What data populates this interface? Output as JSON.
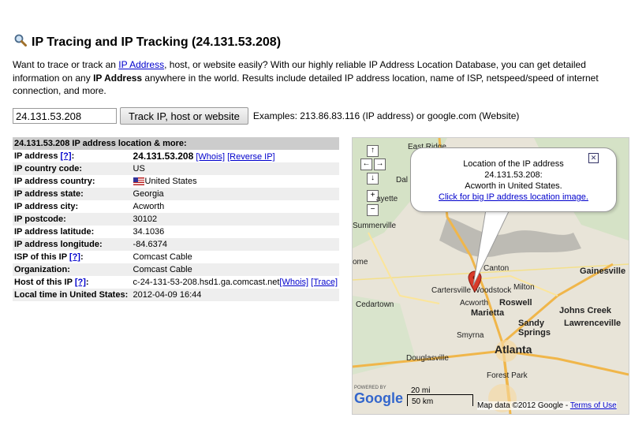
{
  "header": {
    "title": "IP Tracing and IP Tracking (24.131.53.208)",
    "icon": "magnifier-icon"
  },
  "intro": {
    "part1": "Want to trace or track an ",
    "link_ip": "IP Address",
    "part2": ", host, or website easily? With our highly reliable IP Address Location Database, you can get detailed information on any ",
    "bold_ip": "IP Address",
    "part3": " anywhere in the world. Results include detailed IP address location, name of ISP, netspeed/speed of internet connection, and more."
  },
  "search": {
    "value": "24.131.53.208",
    "button_label": "Track IP, host or website",
    "examples": "Examples: 213.86.83.116 (IP address) or google.com (Website)"
  },
  "table": {
    "header": "24.131.53.208 IP address location & more:",
    "rows": [
      {
        "label": "IP address",
        "help": "[?]",
        "value": "24.131.53.208",
        "link1": "[Whois]",
        "link2": "[Reverse IP]"
      },
      {
        "label": "IP country code:",
        "value": "US"
      },
      {
        "label": "IP address country:",
        "value": "United States"
      },
      {
        "label": "IP address state:",
        "value": "Georgia"
      },
      {
        "label": "IP address city:",
        "value": "Acworth"
      },
      {
        "label": "IP postcode:",
        "value": "30102"
      },
      {
        "label": "IP address latitude:",
        "value": "34.1036"
      },
      {
        "label": "IP address longitude:",
        "value": "-84.6374"
      },
      {
        "label": "ISP of this IP",
        "help": "[?]",
        "value": "Comcast Cable"
      },
      {
        "label": "Organization:",
        "value": "Comcast Cable"
      },
      {
        "label": "Host of this IP",
        "help": "[?]",
        "value": "c-24-131-53-208.hsd1.ga.comcast.net",
        "link1": "[Whois]",
        "link2": "[Trace]"
      },
      {
        "label": "Local time in United States:",
        "value": "2012-04-09 16:44"
      }
    ]
  },
  "map": {
    "bubble": {
      "line1": "Location of the IP address",
      "line2": "24.131.53.208:",
      "line3": "Acworth in United States.",
      "link": "Click for big IP address location image."
    },
    "labels": {
      "east_ridge": "East Ridge",
      "dalton": "Dal",
      "lafayette": "ayette",
      "summerville": "Summerville",
      "cartersville": "Cartersville",
      "woodstock": "Woodstock",
      "acworth": "Acworth",
      "canton": "Canton",
      "milton": "Milton",
      "roswell": "Roswell",
      "marietta": "Marietta",
      "johns_creek": "Johns Creek",
      "gainesville": "Gainesville",
      "lawrenceville": "Lawrenceville",
      "sandy_springs": "Sandy Springs",
      "smyrna": "Smyrna",
      "atlanta": "Atlanta",
      "cedartown": "Cedartown",
      "douglasville": "Douglasville",
      "forest_park": "Forest Park",
      "rome": "ome"
    },
    "scale_mi": "20 mi",
    "scale_km": "50 km",
    "attribution": "Map data ©2012 Google - ",
    "terms": "Terms of Use",
    "google": "Google",
    "powered": "POWERED BY"
  },
  "colors": {
    "link": "#0000cc",
    "row_alt": "#eeeeee",
    "header_bg": "#cccccc",
    "pin": "#d83a2a"
  }
}
